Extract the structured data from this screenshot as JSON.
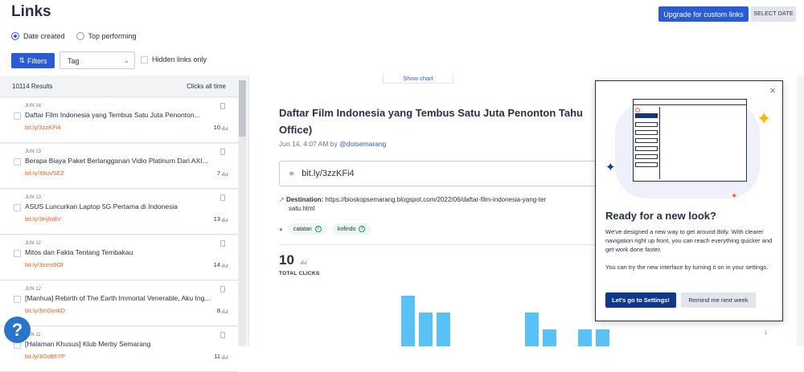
{
  "header": {
    "title": "Links",
    "upgrade_label": "Upgrade for custom links",
    "select_date_label": "SELECT DATE"
  },
  "sort": {
    "options": [
      "Date created",
      "Top performing"
    ],
    "selected": "Date created"
  },
  "toolbar": {
    "filters_label": "Filters",
    "tag_placeholder": "Tag",
    "hidden_links_label": "Hidden links only"
  },
  "list": {
    "results_label": "10114 Results",
    "clicks_label": "Clicks all time",
    "items": [
      {
        "date": "JUN 14",
        "title": "Daftar Film Indonesia yang Tembus Satu Juta Penonton...",
        "link": "bit.ly/3zzKFi4",
        "clicks": "10"
      },
      {
        "date": "JUN 13",
        "title": "Berapa Biaya Paket Berlangganan Vidio Platinum Dari AXI...",
        "link": "bit.ly/39uV5EZ",
        "clicks": "7"
      },
      {
        "date": "JUN 13",
        "title": "ASUS Luncurkan Laptop 5G Pertama di Indonesia",
        "link": "bit.ly/3HjfoBV",
        "clicks": "13"
      },
      {
        "date": "JUN 12",
        "title": "Mitos dan Fakta Tentang Tembakau",
        "link": "bit.ly/3zzm9Of",
        "clicks": "14"
      },
      {
        "date": "JUN 12",
        "title": "[Manhua] Rebirth of The Earth Immortal Venerable, Aku Ing...",
        "link": "bit.ly/3mDyskD",
        "clicks": "8"
      },
      {
        "date": "JUN 11",
        "title": "[Halaman Khusus] Klub Merby Semarang",
        "link": "bit.ly/3OoBh7P",
        "clicks": "11"
      }
    ]
  },
  "detail": {
    "show_chart_label": "Show chart",
    "title": "Daftar Film Indonesia yang Tembus Satu Juta Penonton Tahun... Office)",
    "title_line1": "Daftar Film Indonesia yang Tembus Satu Juta Penonton Tahu",
    "title_line2": "Office)",
    "date_prefix": "Jun 14, 4:07 AM by ",
    "author": "@dotsemarang",
    "short_link": "bit.ly/3zzKFi4",
    "destination_label": "Destination:",
    "destination_url": "https://bioskopsemarang.blogspot.com/2022/06/daftar-film-indonesia-yang-ter",
    "destination_url_cont": "satu.html",
    "tags": [
      "catatan",
      "kofindo"
    ],
    "total_clicks": "10",
    "total_clicks_label": "TOTAL CLICKS",
    "axis_tick": "1"
  },
  "chart_data": {
    "type": "bar",
    "values": [
      3,
      2,
      2,
      0,
      0,
      0,
      0,
      2,
      1,
      0,
      1,
      1
    ]
  },
  "modal": {
    "close_label": "×",
    "heading": "Ready for a new look?",
    "para1": "We've designed a new way to get around Bitly. With clearer navigation right up front, you can reach everything quicker and get work done faster.",
    "para2": "You can try the new interface by turning it on in your settings.",
    "primary_label": "Let's go to Settings!",
    "secondary_label": "Remind me next week"
  },
  "help_label": "?"
}
